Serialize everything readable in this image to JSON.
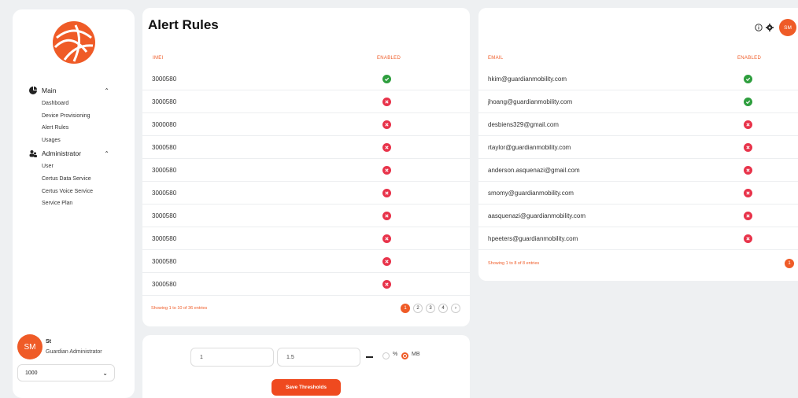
{
  "header": {
    "title": "Alert Rules",
    "avatar_initials": "SM",
    "accent": "#ef5b27"
  },
  "sidebar": {
    "groups": [
      {
        "label": "Main",
        "icon": "pie-chart-icon",
        "items": [
          "Dashboard",
          "Device Provisioning",
          "Alert Rules",
          "Usages"
        ]
      },
      {
        "label": "Administrator",
        "icon": "users-icon",
        "items": [
          "User",
          "Certus Data Service",
          "Certus Voice Service",
          "Service Plan"
        ]
      }
    ],
    "user": {
      "initials": "SM",
      "name": "St",
      "role": "Guardian Administrator"
    },
    "account_select": "1000"
  },
  "imei_table": {
    "headers": [
      "IMEI",
      "ENABLED"
    ],
    "rows": [
      {
        "imei": "3000580",
        "enabled": true
      },
      {
        "imei": "3000580",
        "enabled": false
      },
      {
        "imei": "3000080",
        "enabled": false
      },
      {
        "imei": "3000580",
        "enabled": false
      },
      {
        "imei": "3000580",
        "enabled": false
      },
      {
        "imei": "3000580",
        "enabled": false
      },
      {
        "imei": "3000580",
        "enabled": false
      },
      {
        "imei": "3000580",
        "enabled": false
      },
      {
        "imei": "3000580",
        "enabled": false
      },
      {
        "imei": "3000580",
        "enabled": false
      }
    ],
    "footer": "Showing 1 to 10 of 36 entries",
    "pages": [
      "1",
      "2",
      "3",
      "4",
      "›"
    ],
    "active_page": "1"
  },
  "email_table": {
    "headers": [
      "EMAIL",
      "ENABLED"
    ],
    "rows": [
      {
        "email": "hkim@guardianmobility.com",
        "enabled": true
      },
      {
        "email": "jhoang@guardianmobility.com",
        "enabled": true
      },
      {
        "email": "desbiens329@gmail.com",
        "enabled": false
      },
      {
        "email": "rtaylor@guardianmobility.com",
        "enabled": false
      },
      {
        "email": "anderson.asquenazi@gmail.com",
        "enabled": false
      },
      {
        "email": "smomy@guardianmobility.com",
        "enabled": false
      },
      {
        "email": "aasquenazi@guardianmobility.com",
        "enabled": false
      },
      {
        "email": "hpeeters@guardianmobility.com",
        "enabled": false
      }
    ],
    "footer": "Showing 1 to 8 of 8 entries",
    "pages": [
      "1"
    ],
    "active_page": "1"
  },
  "thresholds": {
    "min_value": "1",
    "max_value": "1.5",
    "unit_options": [
      "%",
      "MB"
    ],
    "selected_unit": "MB",
    "save_label": "Save Thresholds"
  },
  "colors": {
    "enabled": "#2e9e3e",
    "disabled": "#e8334a"
  }
}
